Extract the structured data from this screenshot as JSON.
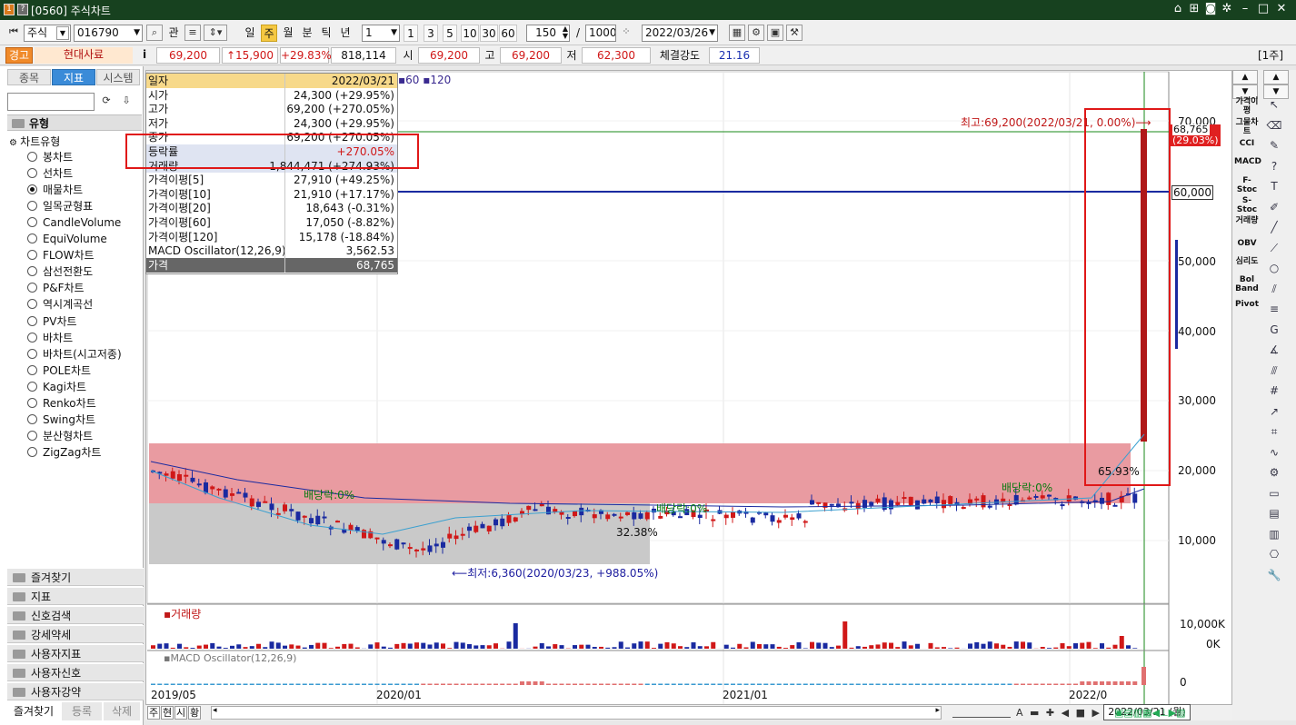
{
  "titlebar": {
    "badge1": "1",
    "badge2": "?",
    "title": "[0560] 주식차트"
  },
  "toolbar": {
    "market": "주식",
    "code": "016790",
    "search_icon": "search-icon",
    "kwan": "관",
    "periods": [
      "일",
      "주",
      "월",
      "분",
      "틱",
      "년"
    ],
    "selected_period": "주",
    "interval": "1",
    "quick": [
      "1",
      "3",
      "5",
      "10",
      "30",
      "60"
    ],
    "count": "150",
    "slash": "/",
    "max": "1000",
    "date": "2022/03/26"
  },
  "pricebar": {
    "warning": "경고",
    "name": "현대사료",
    "info": "i",
    "price": "69,200",
    "change": "↑15,900",
    "rate": "+29.83%",
    "volume": "818,114",
    "open_label": "시",
    "open": "69,200",
    "high_label": "고",
    "high": "69,200",
    "low_label": "저",
    "low": "62,300",
    "strength_label": "체결강도",
    "strength": "21.16",
    "unit": "[1주]"
  },
  "left": {
    "tabs": [
      "종목",
      "지표",
      "시스템"
    ],
    "selected_tab": "지표",
    "section": "유형",
    "group": "차트유형",
    "items": [
      "봉차트",
      "선차트",
      "매물차트",
      "일목균형표",
      "CandleVolume",
      "EquiVolume",
      "FLOW차트",
      "삼선전환도",
      "P&F차트",
      "역시계곡선",
      "PV차트",
      "바차트",
      "바차트(시고저종)",
      "POLE차트",
      "Kagi차트",
      "Renko차트",
      "Swing차트",
      "분산형차트",
      "ZigZag차트"
    ],
    "selected_item": "매물차트",
    "folders": [
      "즐겨찾기",
      "지표",
      "신호검색",
      "강세약세",
      "사용자지표",
      "사용자신호",
      "사용자강약"
    ],
    "bottom_tabs": [
      "즐겨찾기",
      "등록",
      "삭제"
    ]
  },
  "info": {
    "rows": [
      {
        "k": "일자",
        "v": "2022/03/21"
      },
      {
        "k": "시가",
        "v": "24,300 (+29.95%)"
      },
      {
        "k": "고가",
        "v": "69,200 (+270.05%)"
      },
      {
        "k": "저가",
        "v": "24,300 (+29.95%)"
      },
      {
        "k": "종가",
        "v": "69,200 (+270.05%)"
      },
      {
        "k": "등락률",
        "v": "+270.05%"
      },
      {
        "k": "거래량",
        "v": "1,844,471 (+274.93%)"
      },
      {
        "k": "가격이평[5]",
        "v": "27,910 (+49.25%)"
      },
      {
        "k": "가격이평[10]",
        "v": "21,910 (+17.17%)"
      },
      {
        "k": "가격이평[20]",
        "v": "18,643 (-0.31%)"
      },
      {
        "k": "가격이평[60]",
        "v": "17,050 (-8.82%)"
      },
      {
        "k": "가격이평[120]",
        "v": "15,178 (-18.84%)"
      },
      {
        "k": "MACD Oscillator(12,26,9)",
        "v": "3,562.53"
      },
      {
        "k": "가격",
        "v": "68,765"
      }
    ],
    "legend_60": "60",
    "legend_120": "120"
  },
  "chart": {
    "high_annot": "최고:69,200(2022/03/21, 0.00%)⟶",
    "low_annot": "⟵최저:6,360(2020/03/23, +988.05%)",
    "div1": "배당락:0%",
    "div2": "배당락:0%",
    "div3": "배당락:0%",
    "pct_left": "32.38%",
    "pct_right": "65.93%",
    "y_labels": [
      "70,000",
      "60,000",
      "50,000",
      "40,000",
      "30,000",
      "20,000",
      "10,000"
    ],
    "hline_label": "60,000",
    "cur_price": "68,765",
    "cur_pct": "(29.03%)",
    "volume_title": "거래량",
    "volume_labels": [
      "10,000K",
      "0K"
    ],
    "macd_title": "MACD Oscillator(12,26,9)",
    "macd_label": "0",
    "x_labels": [
      "2019/05",
      "2020/01",
      "2021/01",
      "2022/0"
    ],
    "cursor_date": "2022/03/21 (월)",
    "bottom_tabs": [
      "주",
      "현",
      "시",
      "황"
    ]
  },
  "right_indicators": [
    "가격이평",
    "그물차트",
    "CCI",
    "MACD",
    "F-Stoc",
    "S-Stoc",
    "거래량",
    "OBV",
    "심리도",
    "Bol Band",
    "Pivot"
  ]
}
